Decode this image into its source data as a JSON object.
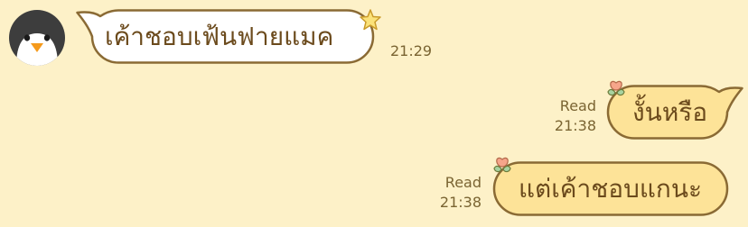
{
  "messages": [
    {
      "side": "incoming",
      "text": "เค้าชอบเฟ้นฟายแมค",
      "time": "21:29",
      "decoration": "star-icon"
    },
    {
      "side": "outgoing",
      "text": "งั้นหรือ",
      "read": "Read",
      "time": "21:38",
      "decoration": "tulip-icon"
    },
    {
      "side": "outgoing",
      "text": "แต่เค้าชอบแกนะ",
      "read": "Read",
      "time": "21:38",
      "decoration": "tulip-icon"
    }
  ],
  "colors": {
    "background": "#fdf1c8",
    "incoming_bubble": "#ffffff",
    "outgoing_bubble": "#fde398",
    "bubble_border": "#8a6a34",
    "text": "#6b4a1c"
  }
}
